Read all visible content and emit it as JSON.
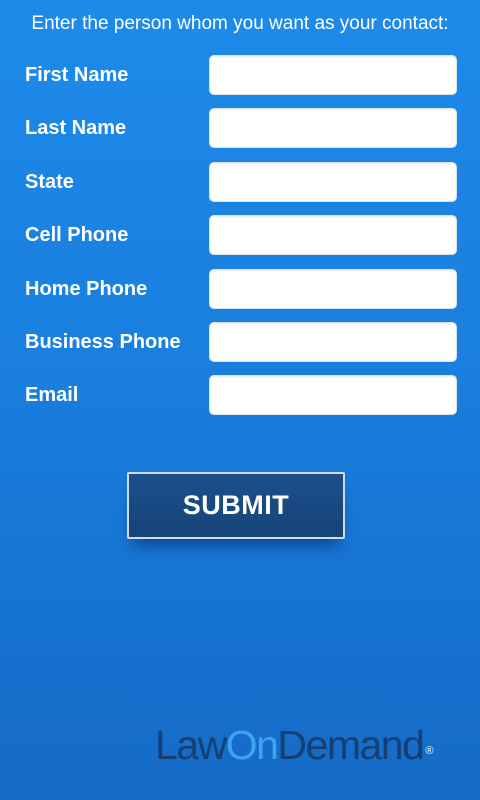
{
  "instruction": "Enter the person whom you want as your contact:",
  "form": {
    "fields": [
      {
        "label": "First Name",
        "value": "",
        "placeholder": ""
      },
      {
        "label": "Last Name",
        "value": "",
        "placeholder": ""
      },
      {
        "label": "State",
        "value": "",
        "placeholder": ""
      },
      {
        "label": "Cell Phone",
        "value": "",
        "placeholder": ""
      },
      {
        "label": "Home Phone",
        "value": "",
        "placeholder": ""
      },
      {
        "label": "Business Phone",
        "value": "",
        "placeholder": ""
      },
      {
        "label": "Email",
        "value": "",
        "placeholder": ""
      }
    ],
    "submit_label": "SUBMIT"
  },
  "logo": {
    "part1": "Law",
    "part2": "On",
    "part3": "Demand",
    "registered_mark": "®"
  },
  "colors": {
    "background_top": "#1d8ae9",
    "background_bottom": "#156bc6",
    "button_fill": "#1a4a84",
    "logo_dark": "#163f73",
    "logo_accent": "#3fa3f2"
  }
}
